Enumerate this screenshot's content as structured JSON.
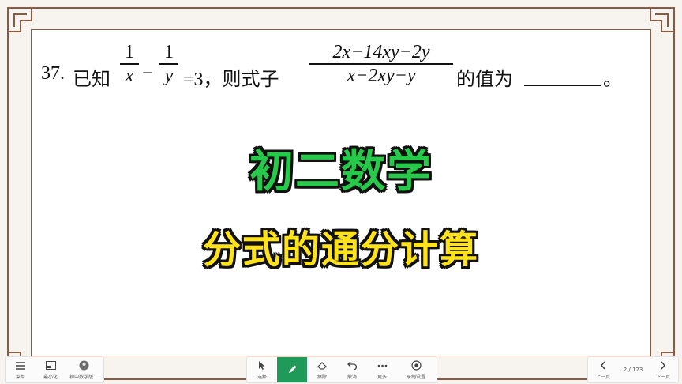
{
  "problem": {
    "number": "37.",
    "intro": "已知",
    "frac1": {
      "num": "1",
      "den": "x"
    },
    "minus": "−",
    "frac2": {
      "num": "1",
      "den": "y"
    },
    "equals": "=3，则式子",
    "frac3": {
      "num": "2x−14xy−2y",
      "den": "x−2xy−y"
    },
    "tail": "的值为",
    "end": "。"
  },
  "titles": {
    "line1": "初二数学",
    "line2": "分式的通分计算"
  },
  "toolbar": {
    "left": [
      {
        "label": "菜单",
        "icon": "menu-icon"
      },
      {
        "label": "最小化",
        "icon": "minimize-icon"
      },
      {
        "label": "初中数学版...",
        "icon": "app-avatar-icon"
      }
    ],
    "center": [
      {
        "label": "选择",
        "icon": "cursor-icon"
      },
      {
        "label": "",
        "icon": "pen-icon"
      },
      {
        "label": "擦除",
        "icon": "eraser-icon"
      },
      {
        "label": "撤消",
        "icon": "undo-icon"
      },
      {
        "label": "更多",
        "icon": "more-icon"
      },
      {
        "label": "录制设置",
        "icon": "record-settings-icon"
      }
    ],
    "right": {
      "prev_label": "上一页",
      "page": "2 / 123",
      "next_label": "下一页"
    }
  },
  "colors": {
    "title1": "#27c94a",
    "title2": "#ffe21a",
    "frame": "#8a5a44",
    "active_tool": "#1f9a58"
  }
}
